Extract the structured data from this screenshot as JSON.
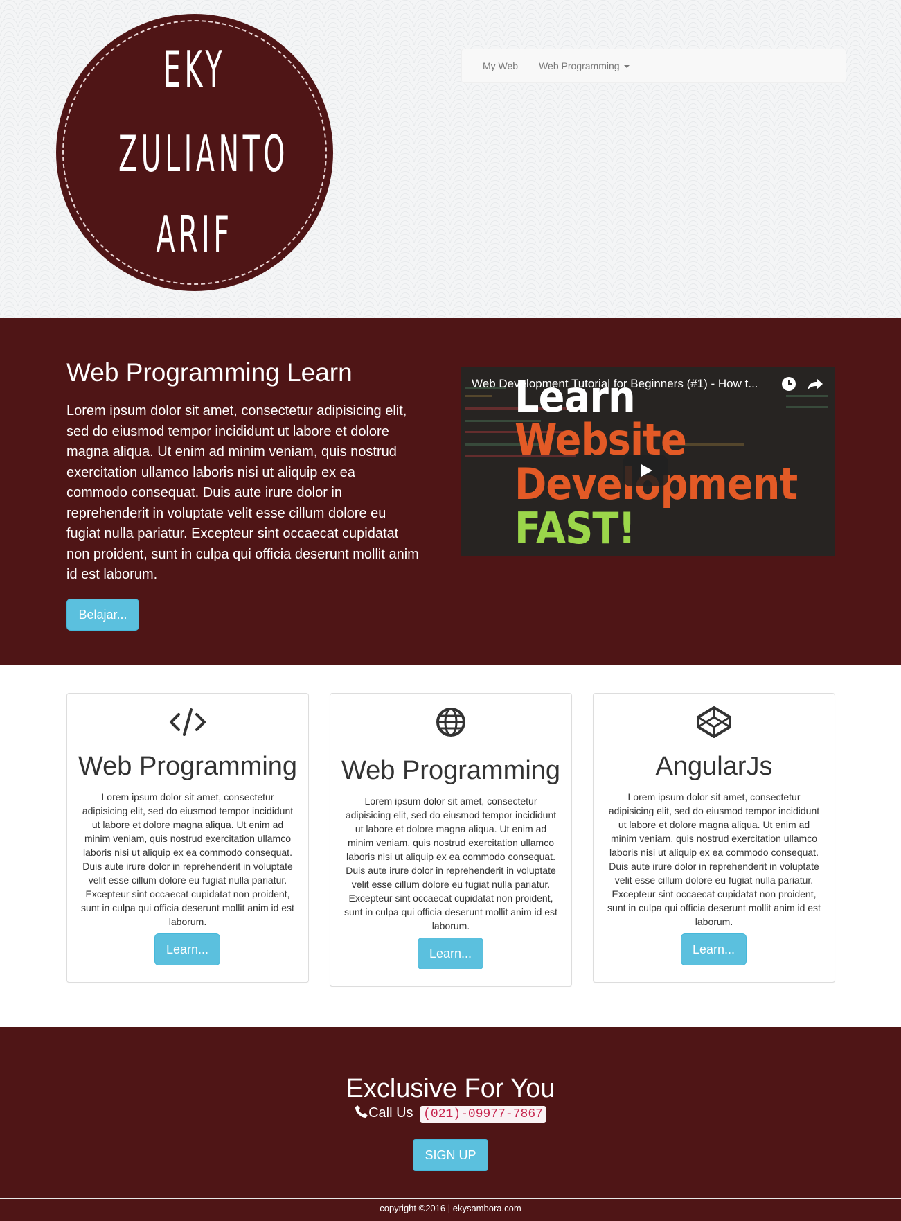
{
  "logo": {
    "lines": [
      "Eky",
      "Zulianto",
      "Arif"
    ]
  },
  "navbar": {
    "items": [
      {
        "label": "My Web"
      },
      {
        "label": "Web Programming"
      }
    ]
  },
  "hero": {
    "title": "Web Programming Learn",
    "text": "Lorem ipsum dolor sit amet, consectetur adipisicing elit, sed do eiusmod tempor incididunt ut labore et dolore magna aliqua. Ut enim ad minim veniam, quis nostrud exercitation ullamco laboris nisi ut aliquip ex ea commodo consequat. Duis aute irure dolor in reprehenderit in voluptate velit esse cillum dolore eu fugiat nulla pariatur. Excepteur sint occaecat cupidatat non proident, sunt in culpa qui officia deserunt mollit anim id est laborum.",
    "button": "Belajar...",
    "video": {
      "title": "Web Development Tutorial for Beginners (#1) - How t...",
      "thumbnail_lines": [
        "Learn",
        "Website",
        "Development",
        "FAST!"
      ]
    }
  },
  "cards": [
    {
      "icon": "code-icon",
      "title": "Web Programming",
      "text": "Lorem ipsum dolor sit amet, consectetur adipisicing elit, sed do eiusmod tempor incididunt ut labore et dolore magna aliqua. Ut enim ad minim veniam, quis nostrud exercitation ullamco laboris nisi ut aliquip ex ea commodo consequat. Duis aute irure dolor in reprehenderit in voluptate velit esse cillum dolore eu fugiat nulla pariatur. Excepteur sint occaecat cupidatat non proident, sunt in culpa qui officia deserunt mollit anim id est laborum.",
      "button": "Learn..."
    },
    {
      "icon": "globe-icon",
      "title": "Web Programming",
      "text": "Lorem ipsum dolor sit amet, consectetur adipisicing elit, sed do eiusmod tempor incididunt ut labore et dolore magna aliqua. Ut enim ad minim veniam, quis nostrud exercitation ullamco laboris nisi ut aliquip ex ea commodo consequat. Duis aute irure dolor in reprehenderit in voluptate velit esse cillum dolore eu fugiat nulla pariatur. Excepteur sint occaecat cupidatat non proident, sunt in culpa qui officia deserunt mollit anim id est laborum.",
      "button": "Learn..."
    },
    {
      "icon": "codepen-icon",
      "title": "AngularJs",
      "text": "Lorem ipsum dolor sit amet, consectetur adipisicing elit, sed do eiusmod tempor incididunt ut labore et dolore magna aliqua. Ut enim ad minim veniam, quis nostrud exercitation ullamco laboris nisi ut aliquip ex ea commodo consequat. Duis aute irure dolor in reprehenderit in voluptate velit esse cillum dolore eu fugiat nulla pariatur. Excepteur sint occaecat cupidatat non proident, sunt in culpa qui officia deserunt mollit anim id est laborum.",
      "button": "Learn..."
    }
  ],
  "footer": {
    "title": "Exclusive For You",
    "call_label": "Call Us",
    "phone": "(021)-09977-7867",
    "signup": "SIGN UP",
    "copyright": "copyright ©2016 | ekysambora.com"
  },
  "colors": {
    "brand": "#4f1516",
    "button": "#5bc0de",
    "code_text": "#c7254e"
  }
}
